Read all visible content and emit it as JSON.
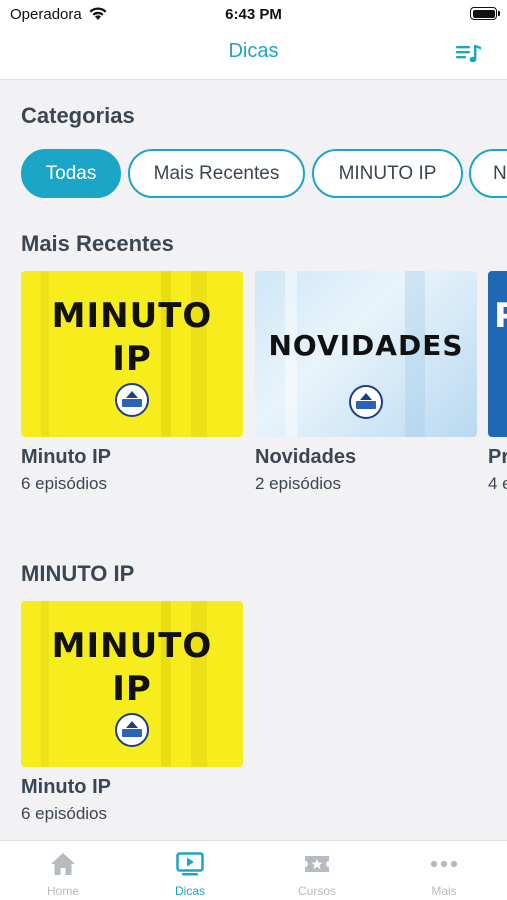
{
  "status_bar": {
    "carrier": "Operadora",
    "time": "6:43 PM"
  },
  "nav": {
    "title": "Dicas",
    "right_icon": "playlist-icon"
  },
  "categories": {
    "title": "Categorias",
    "chips": [
      {
        "label": "Todas",
        "selected": true
      },
      {
        "label": "Mais Recentes",
        "selected": false
      },
      {
        "label": "MINUTO IP",
        "selected": false
      },
      {
        "label": "N",
        "selected": false
      }
    ]
  },
  "sections": [
    {
      "title": "Mais Recentes",
      "items": [
        {
          "title": "Minuto IP",
          "subtitle": "6 episódios",
          "thumb_text": [
            "MINUTO",
            "IP"
          ],
          "thumb_color": "#f7ec1c"
        },
        {
          "title": "Novidades",
          "subtitle": "2 episódios",
          "thumb_text": [
            "NOVIDADES"
          ],
          "thumb_color": "#d9ecf8"
        },
        {
          "title": "Pr",
          "subtitle": "4 e",
          "thumb_text": [
            "P"
          ],
          "thumb_color": "#1f68b3"
        }
      ]
    },
    {
      "title": "MINUTO IP",
      "items": [
        {
          "title": "Minuto IP",
          "subtitle": "6 episódios",
          "thumb_text": [
            "MINUTO",
            "IP"
          ],
          "thumb_color": "#f7ec1c"
        }
      ]
    }
  ],
  "tabs": [
    {
      "label": "Home",
      "icon": "home-icon",
      "active": false
    },
    {
      "label": "Dicas",
      "icon": "video-icon",
      "active": true
    },
    {
      "label": "Cursos",
      "icon": "ticket-star-icon",
      "active": false
    },
    {
      "label": "Mais",
      "icon": "more-dots-icon",
      "active": false
    }
  ],
  "colors": {
    "accent": "#1ba5c6",
    "text": "#3c4653",
    "background": "#f2f2f4",
    "tab_inactive": "#b6bbc1"
  }
}
